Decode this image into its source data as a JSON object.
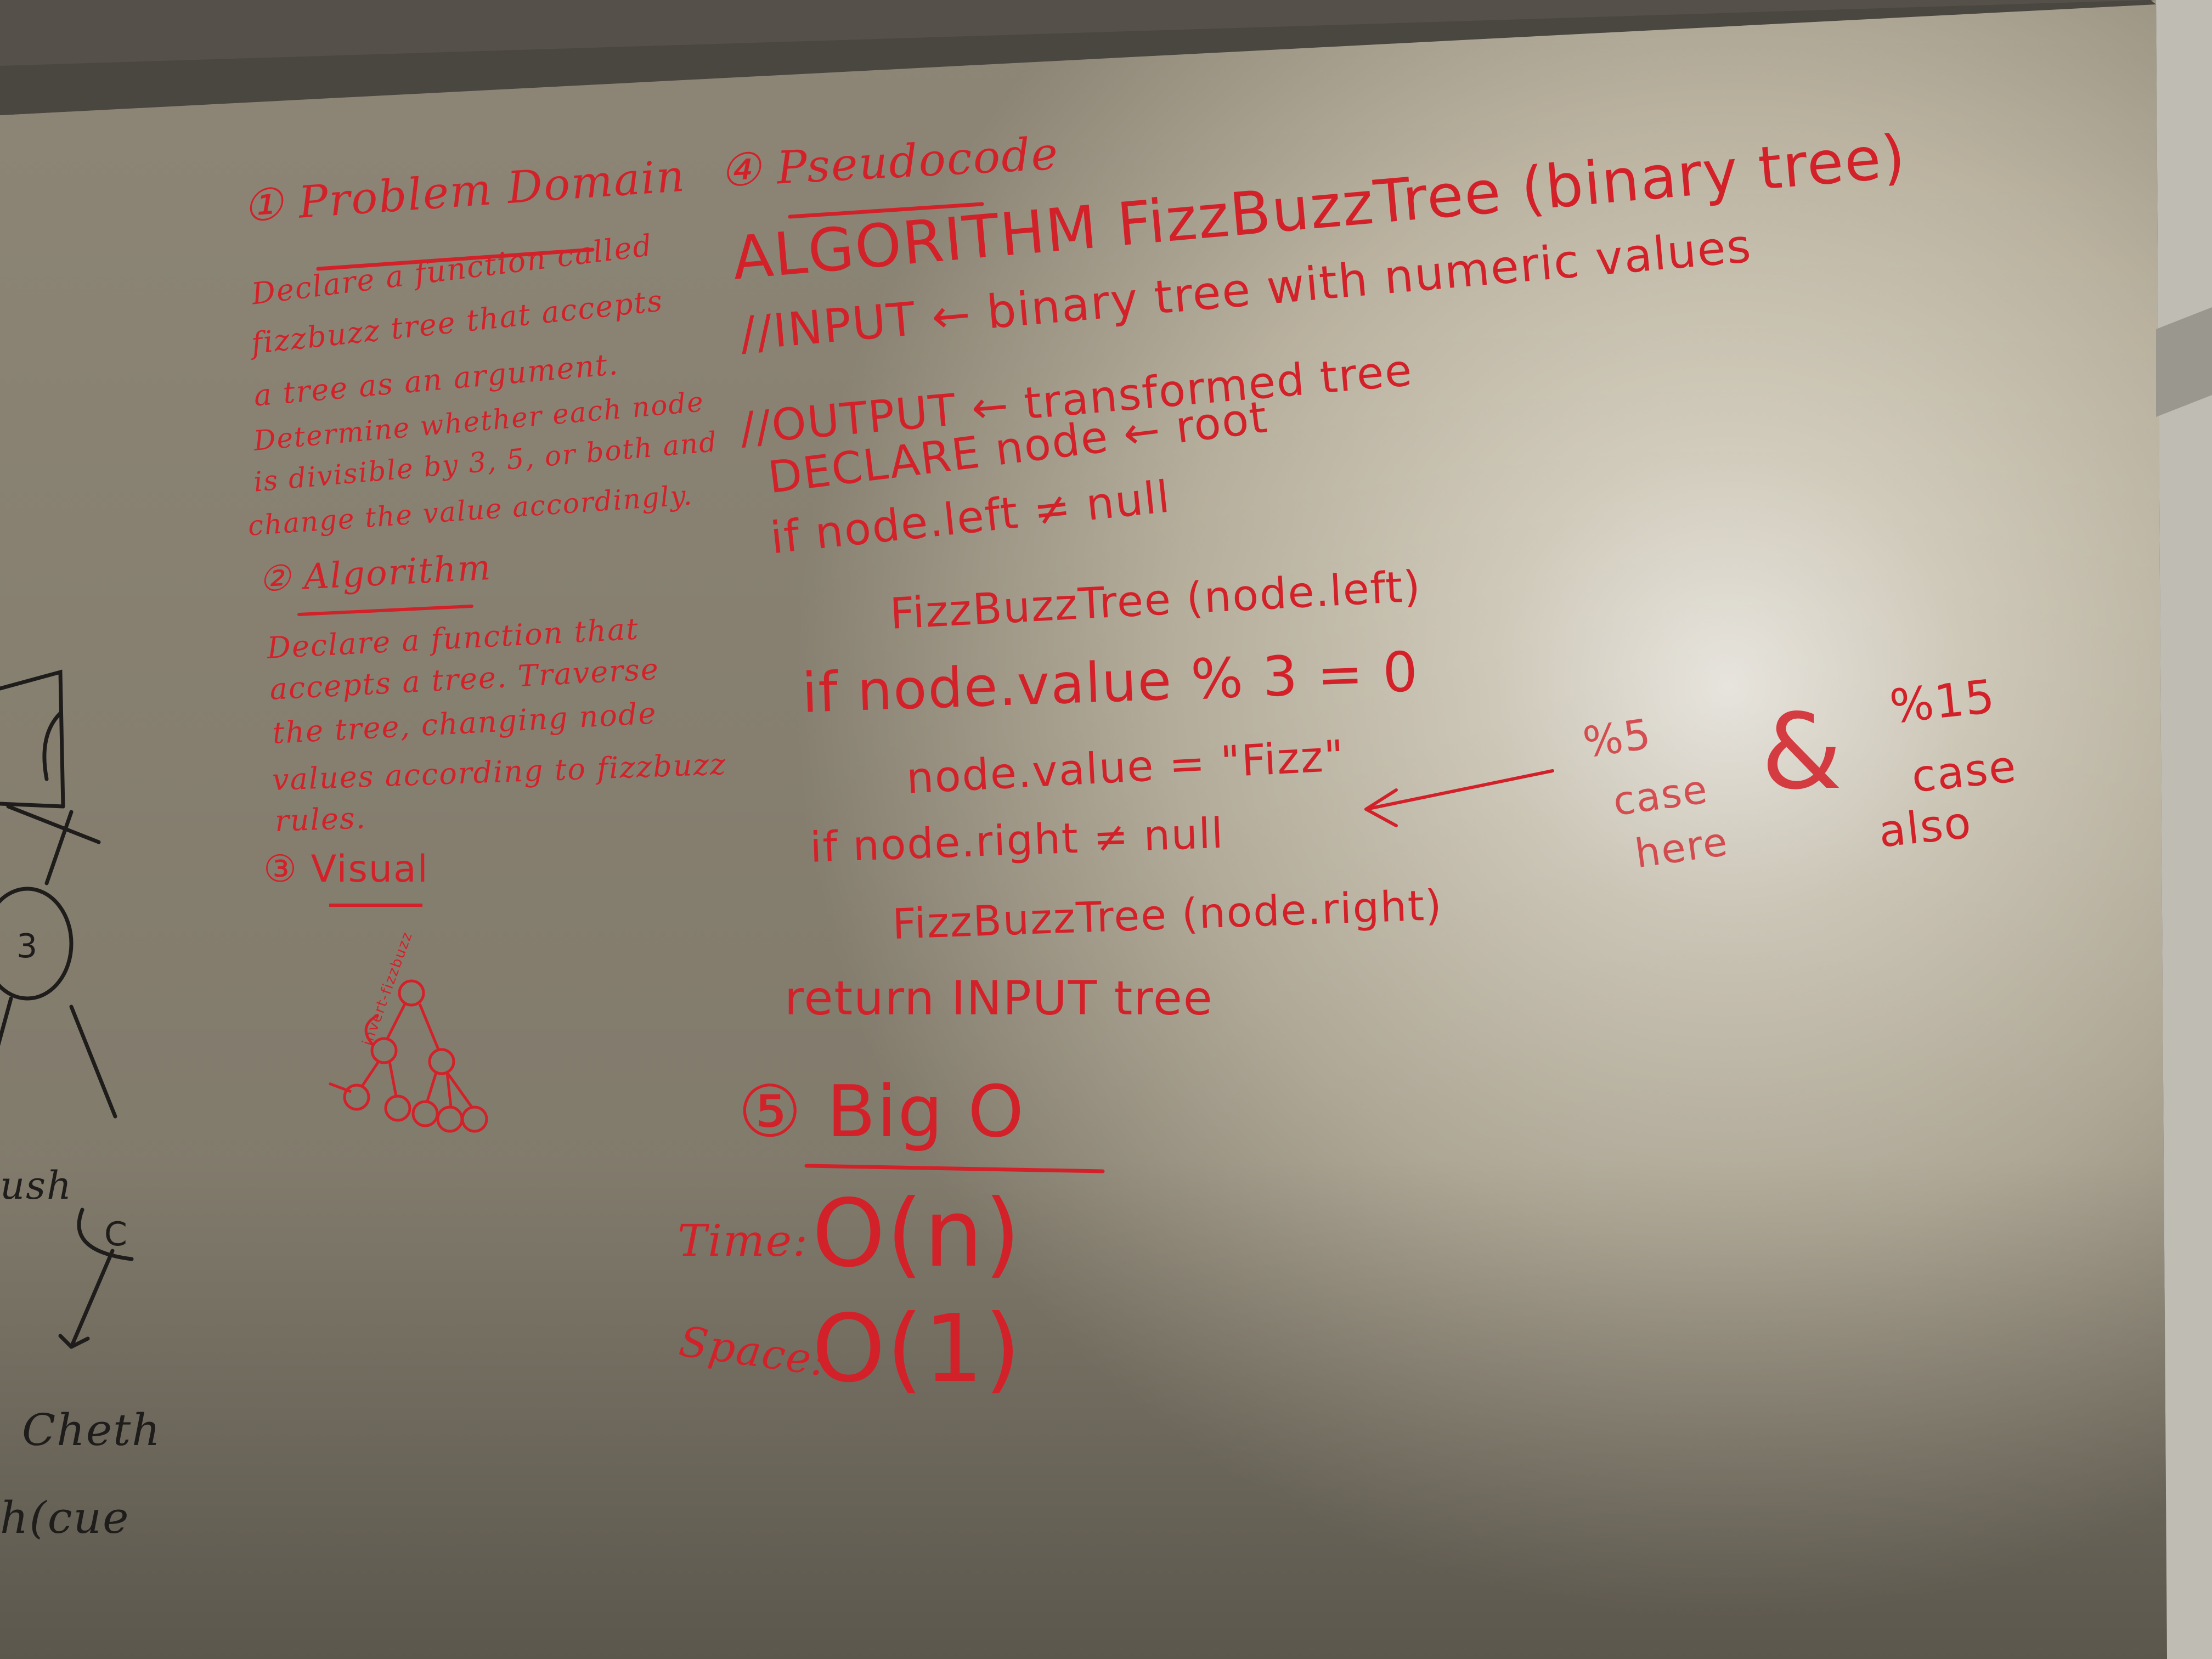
{
  "problem_domain": {
    "heading": "① Problem Domain",
    "lines": [
      "Declare a function called",
      "fizzbuzz tree that accepts",
      "a tree as an argument.",
      "Determine whether each node",
      "is divisible by 3, 5, or both and",
      "change the value accordingly."
    ]
  },
  "algorithm": {
    "heading": "② Algorithm",
    "lines": [
      "Declare a function that",
      "accepts a tree. Traverse",
      "the tree, changing node",
      "values according to fizzbuzz",
      "rules."
    ]
  },
  "visual": {
    "heading": "③ Visual",
    "tree_label": "invert-fizzbuzz"
  },
  "pseudocode": {
    "heading": "④ Pseudocode",
    "lines": [
      "ALGORITHM  FizzBuzzTree (binary tree)",
      "//INPUT ← binary tree with numeric values",
      "//OUTPUT ← transformed tree",
      "DECLARE node ← root",
      "if node.left ≠ null",
      "FizzBuzzTree (node.left)",
      "if node.value % 3 = 0",
      "node.value = \"Fizz\"",
      "if node.right ≠ null",
      "FizzBuzzTree (node.right)",
      "return INPUT tree"
    ]
  },
  "side_note": {
    "left_lines": [
      "%5",
      "case",
      "here"
    ],
    "amp": "&",
    "right_lines": [
      "%15",
      "case",
      "also"
    ]
  },
  "big_o": {
    "heading": "⑤ Big O",
    "time_label": "Time:",
    "time_value": "O(n)",
    "space_label": "Space:",
    "space_value": "O(1)"
  },
  "left_edge": {
    "node_label": "3",
    "push_fragment": "ush",
    "c_label": "C",
    "cheth_fragment": "Cheth",
    "queue_fragment": "h(cue"
  },
  "colors": {
    "ink_red": "#d3212a",
    "ink_black": "#1f1d1b",
    "board": "#c9c2b0",
    "frame": "#3a3733"
  }
}
